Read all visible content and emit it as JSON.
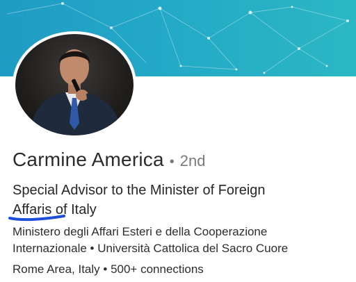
{
  "profile": {
    "name": "Carmine America",
    "separator": "•",
    "connection_degree": "2nd",
    "headline": "Special Advisor to the Minister of Foreign Affaris of Italy",
    "headline_line1": "Special Advisor to the Minister of Foreign",
    "headline_line2": "Affaris of Italy",
    "company_line1": "Ministero degli Affari Esteri e della Cooperazione",
    "company_line2": "Internazionale • Università Cattolica del Sacro Cuore",
    "location_line": "Rome Area, Italy • 500+ connections"
  },
  "colors": {
    "banner": "#1f9bc4",
    "underline": "#1d4fd8"
  }
}
